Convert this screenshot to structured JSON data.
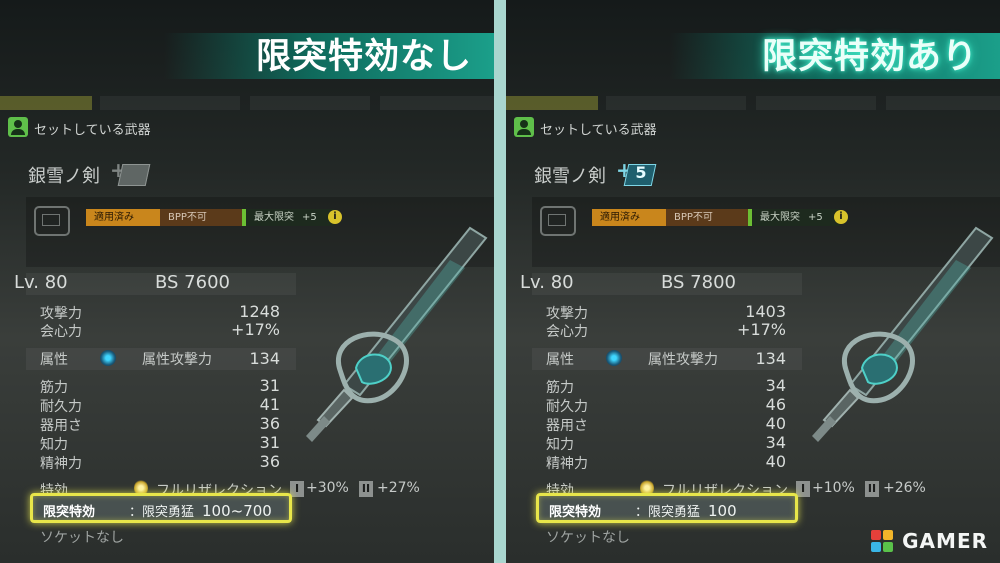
{
  "panels": {
    "left": {
      "banner_title": "限突特効なし",
      "header_label": "セットしている武器",
      "weapon_name": "銀雪ノ剣",
      "plus_level": "",
      "tags": {
        "applied": "適用済み",
        "bpp": "BPP不可",
        "limit_label": "最大限突",
        "limit_value": "+5"
      },
      "info_icon": "i",
      "level": "Lv. 80",
      "bs": "BS 7600",
      "stats": {
        "attack_label": "攻撃力",
        "attack": "1248",
        "crit_label": "会心力",
        "crit": "+17%",
        "attr_label": "属性",
        "attr_attack_label": "属性攻撃力",
        "attr_attack": "134",
        "str_label": "筋力",
        "str": "31",
        "dur_label": "耐久力",
        "dur": "41",
        "dex_label": "器用さ",
        "dex": "36",
        "int_label": "知力",
        "int": "31",
        "spr_label": "精神力",
        "spr": "36"
      },
      "tokko": {
        "label": "特効",
        "skill": "フルリザレクション",
        "i_label": "I",
        "i_value": "+30%",
        "ii_label": "II",
        "ii_value": "+27%"
      },
      "genkai": {
        "label": "限突特効",
        "value_label": "：限突勇猛",
        "value": "100~700"
      },
      "socket": "ソケットなし"
    },
    "right": {
      "banner_title": "限突特効あり",
      "header_label": "セットしている武器",
      "weapon_name": "銀雪ノ剣",
      "plus_level": "5",
      "tags": {
        "applied": "適用済み",
        "bpp": "BPP不可",
        "limit_label": "最大限突",
        "limit_value": "+5"
      },
      "info_icon": "i",
      "level": "Lv. 80",
      "bs": "BS 7800",
      "stats": {
        "attack_label": "攻撃力",
        "attack": "1403",
        "crit_label": "会心力",
        "crit": "+17%",
        "attr_label": "属性",
        "attr_attack_label": "属性攻撃力",
        "attr_attack": "134",
        "str_label": "筋力",
        "str": "34",
        "dur_label": "耐久力",
        "dur": "46",
        "dex_label": "器用さ",
        "dex": "40",
        "int_label": "知力",
        "int": "34",
        "spr_label": "精神力",
        "spr": "40"
      },
      "tokko": {
        "label": "特効",
        "skill": "フルリザレクション",
        "i_label": "I",
        "i_value": "+10%",
        "ii_label": "II",
        "ii_value": "+26%"
      },
      "genkai": {
        "label": "限突特効",
        "value_label": "：限突勇猛",
        "value": "100"
      },
      "socket": "ソケットなし"
    }
  },
  "watermark": {
    "text": "GAMER"
  },
  "colors": {
    "accent_green": "#1b9f8a",
    "highlight_yellow": "#e8e64a",
    "divider": "#a9d6cf"
  }
}
